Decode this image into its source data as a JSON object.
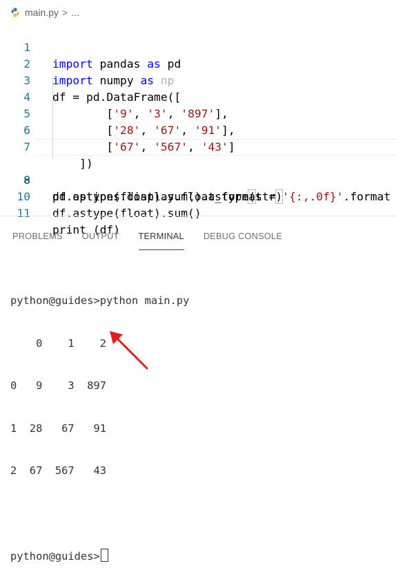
{
  "breadcrumb": {
    "file_name": "main.py",
    "separator": ">",
    "ellipsis": "...",
    "file_icon": "python-file-icon"
  },
  "editor": {
    "lines": [
      {
        "number": "1",
        "text": "import pandas as pd"
      },
      {
        "number": "2",
        "text": "import numpy as np"
      },
      {
        "number": "3",
        "text": "df = pd.DataFrame(["
      },
      {
        "number": "4",
        "text": "['9', '3', '897'],"
      },
      {
        "number": "5",
        "text": "['28', '67', '91'],"
      },
      {
        "number": "6",
        "text": "['67', '567', '43']"
      },
      {
        "number": "7",
        "text": "])"
      },
      {
        "number": "8",
        "text": "df.astype(float).sum().astype(str)"
      },
      {
        "number": "9",
        "text": "pd.options.display.float_format = '{:,.0f}'.format"
      },
      {
        "number": "10",
        "text": "df.astype(float).sum()"
      },
      {
        "number": "11",
        "text": "print (df)"
      }
    ],
    "active_line": "8"
  },
  "panel": {
    "tabs": [
      {
        "label": "PROBLEMS",
        "active": false
      },
      {
        "label": "OUTPUT",
        "active": false
      },
      {
        "label": "TERMINAL",
        "active": true
      },
      {
        "label": "DEBUG CONSOLE",
        "active": false
      }
    ]
  },
  "terminal": {
    "lines": [
      "python@guides>python main.py",
      "    0    1    2",
      "0   9    3  897",
      "1  28   67   91",
      "2  67  567   43",
      "",
      "python@guides>"
    ]
  },
  "colors": {
    "keyword": "#0000ff",
    "string": "#a31515",
    "line_number": "#237893",
    "annotation_arrow": "#e02020"
  }
}
